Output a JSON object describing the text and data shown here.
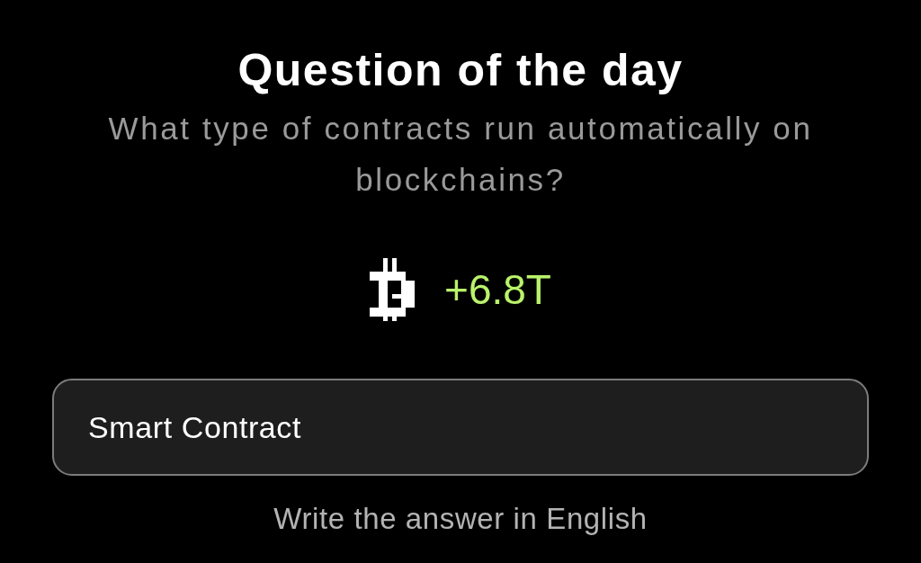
{
  "title": "Question of the day",
  "question": "What type of contracts run automatically on blockchains?",
  "reward": {
    "amount": "+6.8T"
  },
  "answer_field": {
    "value": "Smart Contract"
  },
  "hint": "Write the answer in English"
}
